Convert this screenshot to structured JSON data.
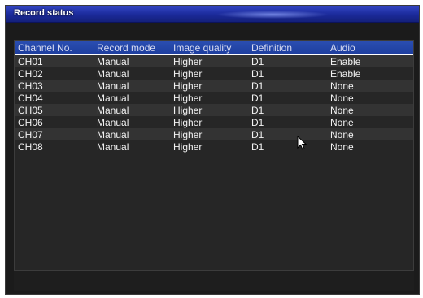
{
  "window": {
    "title": "Record status"
  },
  "table": {
    "headers": [
      "Channel No.",
      "Record mode",
      "Image quality",
      "Definition",
      "Audio"
    ],
    "rows": [
      [
        "CH01",
        "Manual",
        "Higher",
        "D1",
        "Enable"
      ],
      [
        "CH02",
        "Manual",
        "Higher",
        "D1",
        "Enable"
      ],
      [
        "CH03",
        "Manual",
        "Higher",
        "D1",
        "None"
      ],
      [
        "CH04",
        "Manual",
        "Higher",
        "D1",
        "None"
      ],
      [
        "CH05",
        "Manual",
        "Higher",
        "D1",
        "None"
      ],
      [
        "CH06",
        "Manual",
        "Higher",
        "D1",
        "None"
      ],
      [
        "CH07",
        "Manual",
        "Higher",
        "D1",
        "None"
      ],
      [
        "CH08",
        "Manual",
        "Higher",
        "D1",
        "None"
      ]
    ]
  },
  "colors": {
    "titlebar": "#1b2a9a",
    "header": "#1d3d9e",
    "background": "#1b1b1b"
  },
  "icons": {
    "cursor": "mouse-pointer-icon"
  }
}
